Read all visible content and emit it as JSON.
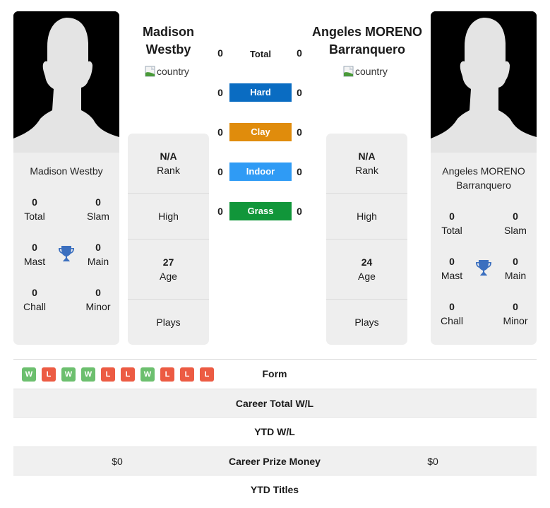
{
  "player1": {
    "name_header": [
      "Madison",
      "Westby"
    ],
    "card_name": "Madison Westby",
    "flag_alt": "country",
    "titles": {
      "total": {
        "value": "0",
        "label": "Total"
      },
      "slam": {
        "value": "0",
        "label": "Slam"
      },
      "mast": {
        "value": "0",
        "label": "Mast"
      },
      "main": {
        "value": "0",
        "label": "Main"
      },
      "chall": {
        "value": "0",
        "label": "Chall"
      },
      "minor": {
        "value": "0",
        "label": "Minor"
      }
    },
    "stats": {
      "rank_value": "N/A",
      "rank_label": "Rank",
      "high_label": "High",
      "age_value": "27",
      "age_label": "Age",
      "plays_label": "Plays"
    },
    "form": [
      "W",
      "L",
      "W",
      "W",
      "L",
      "L",
      "W",
      "L",
      "L",
      "L"
    ],
    "career_prize_money": "$0"
  },
  "player2": {
    "name_header": [
      "Angeles MORENO",
      "Barranquero"
    ],
    "card_name": [
      "Angeles MORENO",
      "Barranquero"
    ],
    "flag_alt": "country",
    "titles": {
      "total": {
        "value": "0",
        "label": "Total"
      },
      "slam": {
        "value": "0",
        "label": "Slam"
      },
      "mast": {
        "value": "0",
        "label": "Mast"
      },
      "main": {
        "value": "0",
        "label": "Main"
      },
      "chall": {
        "value": "0",
        "label": "Chall"
      },
      "minor": {
        "value": "0",
        "label": "Minor"
      }
    },
    "stats": {
      "rank_value": "N/A",
      "rank_label": "Rank",
      "high_label": "High",
      "age_value": "24",
      "age_label": "Age",
      "plays_label": "Plays"
    },
    "career_prize_money": "$0"
  },
  "surfaces": [
    {
      "label": "Total",
      "p1": "0",
      "p2": "0",
      "color": null
    },
    {
      "label": "Hard",
      "p1": "0",
      "p2": "0",
      "color": "#0a6cc2"
    },
    {
      "label": "Clay",
      "p1": "0",
      "p2": "0",
      "color": "#e08c0c"
    },
    {
      "label": "Indoor",
      "p1": "0",
      "p2": "0",
      "color": "#2f9bf5"
    },
    {
      "label": "Grass",
      "p1": "0",
      "p2": "0",
      "color": "#11963a"
    }
  ],
  "table": {
    "form_label": "Form",
    "career_wl_label": "Career Total W/L",
    "ytd_wl_label": "YTD W/L",
    "prize_label": "Career Prize Money",
    "ytd_titles_label": "YTD Titles"
  },
  "colors": {
    "win": "#6cbf6e",
    "loss": "#ec5b43",
    "trophy": "#3b6fbf",
    "card_bg": "#eeeeee"
  }
}
